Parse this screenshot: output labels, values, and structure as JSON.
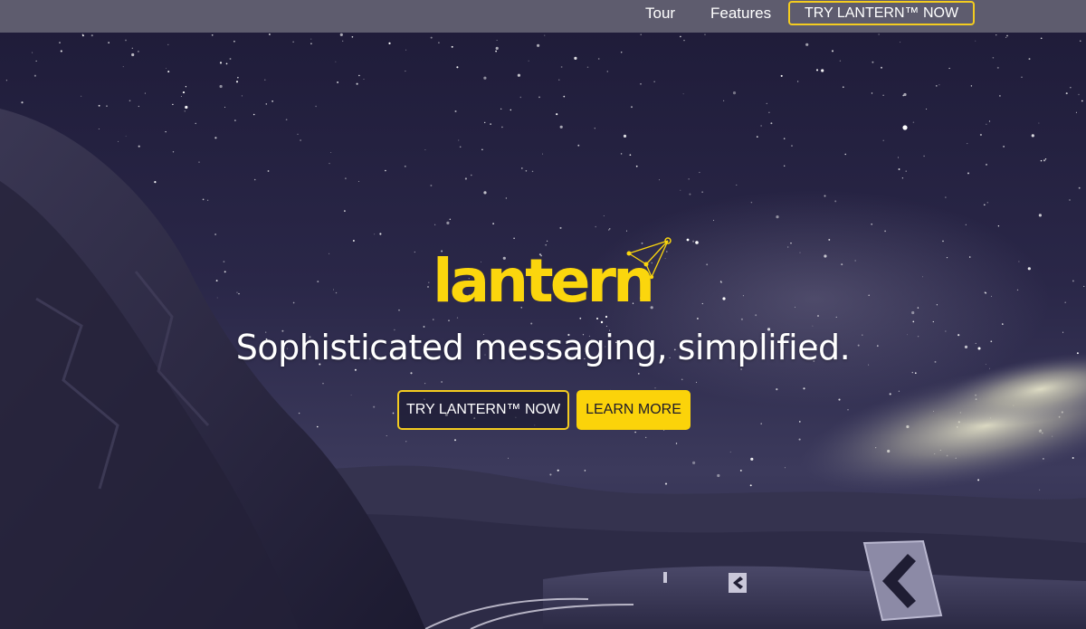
{
  "nav": {
    "tour_label": "Tour",
    "features_label": "Features",
    "cta_label": "TRY LANTERN™ NOW"
  },
  "hero": {
    "logo_text": "lantern",
    "tagline": "Sophisticated messaging, simplified.",
    "primary_button": "TRY LANTERN™ NOW",
    "secondary_button": "LEARN MORE"
  },
  "colors": {
    "accent_yellow": "#fbd30a",
    "nav_background": "#5e5c6e",
    "sky": "#25223f"
  },
  "icons": {
    "constellation": "constellation-icon",
    "chevron_sign": "chevron-left-road-sign"
  }
}
